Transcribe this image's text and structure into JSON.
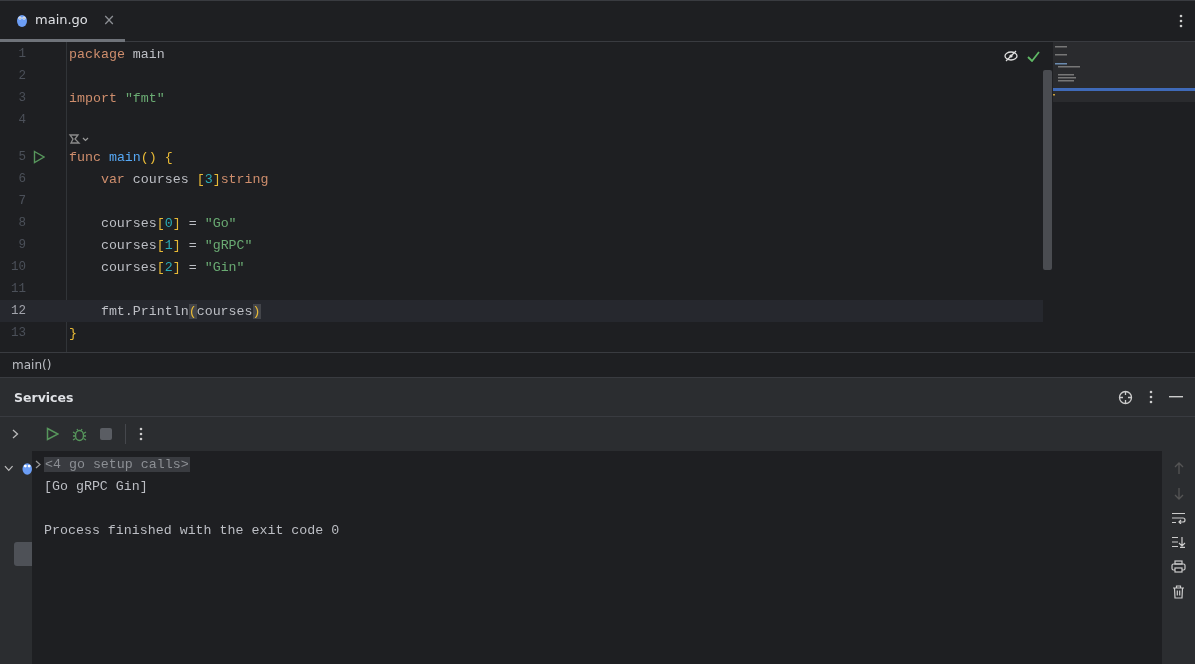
{
  "tabs": [
    {
      "label": "main.go",
      "selected": true,
      "close": "×"
    }
  ],
  "editor": {
    "lines": [
      {
        "kind": "code",
        "number": "1",
        "current": false,
        "runnable": false,
        "indented": false,
        "words": [
          [
            {
              "kind": "keyword",
              "text": "package"
            }
          ],
          [
            {
              "kind": "plain",
              "text": "main"
            }
          ]
        ]
      },
      {
        "kind": "code",
        "number": "2",
        "current": false,
        "runnable": false
      },
      {
        "kind": "code",
        "number": "3",
        "current": false,
        "runnable": false,
        "indented": false,
        "words": [
          [
            {
              "kind": "keyword",
              "text": "import"
            }
          ],
          [
            {
              "kind": "string",
              "text": "\"fmt\""
            }
          ]
        ]
      },
      {
        "kind": "code",
        "number": "4",
        "current": false,
        "runnable": false
      },
      {
        "kind": "hint"
      },
      {
        "kind": "code",
        "number": "5",
        "current": false,
        "runnable": true,
        "indented": false,
        "words": [
          [
            {
              "kind": "keyword",
              "text": "func"
            }
          ],
          [
            {
              "kind": "function",
              "text": "main"
            },
            {
              "kind": "bracket",
              "text": "()"
            }
          ],
          [
            {
              "kind": "bracket",
              "text": "{"
            }
          ]
        ]
      },
      {
        "kind": "code",
        "number": "6",
        "current": false,
        "runnable": false,
        "indented": true,
        "words": [
          [
            {
              "kind": "keyword",
              "text": "var"
            }
          ],
          [
            {
              "kind": "plain",
              "text": "courses"
            }
          ],
          [
            {
              "kind": "bracket",
              "text": "["
            },
            {
              "kind": "number",
              "text": "3"
            },
            {
              "kind": "bracket",
              "text": "]"
            },
            {
              "kind": "keyword",
              "text": "string"
            }
          ]
        ]
      },
      {
        "kind": "code",
        "number": "7",
        "current": false,
        "runnable": false
      },
      {
        "kind": "code",
        "number": "8",
        "current": false,
        "runnable": false,
        "indented": true,
        "words": [
          [
            {
              "kind": "plain",
              "text": "courses"
            },
            {
              "kind": "bracket",
              "text": "["
            },
            {
              "kind": "number",
              "text": "0"
            },
            {
              "kind": "bracket",
              "text": "]"
            }
          ],
          [
            {
              "kind": "plain",
              "text": "="
            }
          ],
          [
            {
              "kind": "string",
              "text": "\"Go\""
            }
          ]
        ]
      },
      {
        "kind": "code",
        "number": "9",
        "current": false,
        "runnable": false,
        "indented": true,
        "words": [
          [
            {
              "kind": "plain",
              "text": "courses"
            },
            {
              "kind": "bracket",
              "text": "["
            },
            {
              "kind": "number",
              "text": "1"
            },
            {
              "kind": "bracket",
              "text": "]"
            }
          ],
          [
            {
              "kind": "plain",
              "text": "="
            }
          ],
          [
            {
              "kind": "string",
              "text": "\"gRPC\""
            }
          ]
        ]
      },
      {
        "kind": "code",
        "number": "10",
        "current": false,
        "runnable": false,
        "indented": true,
        "words": [
          [
            {
              "kind": "plain",
              "text": "courses"
            },
            {
              "kind": "bracket",
              "text": "["
            },
            {
              "kind": "number",
              "text": "2"
            },
            {
              "kind": "bracket",
              "text": "]"
            }
          ],
          [
            {
              "kind": "plain",
              "text": "="
            }
          ],
          [
            {
              "kind": "string",
              "text": "\"Gin\""
            }
          ]
        ]
      },
      {
        "kind": "code",
        "number": "11",
        "current": false,
        "runnable": false
      },
      {
        "kind": "code",
        "number": "12",
        "current": true,
        "runnable": false,
        "indented": true,
        "words": [
          [
            {
              "kind": "plain",
              "text": "fmt.Println"
            },
            {
              "kind": "brace_match",
              "text": "("
            },
            {
              "kind": "plain",
              "text": "courses"
            },
            {
              "kind": "brace_match",
              "text": ")"
            }
          ]
        ]
      },
      {
        "kind": "code",
        "number": "13",
        "current": false,
        "runnable": false,
        "indented": false,
        "words": [
          [
            {
              "kind": "bracket",
              "text": "}"
            }
          ]
        ]
      }
    ]
  },
  "breadcrumb": "main()",
  "services": {
    "title": "Services",
    "console": [
      {
        "kind": "fold",
        "text": "<4 go setup calls>"
      },
      {
        "kind": "output",
        "text": "[Go gRPC Gin]"
      },
      {
        "kind": "exit",
        "text": "Process finished with the exit code 0"
      }
    ]
  }
}
